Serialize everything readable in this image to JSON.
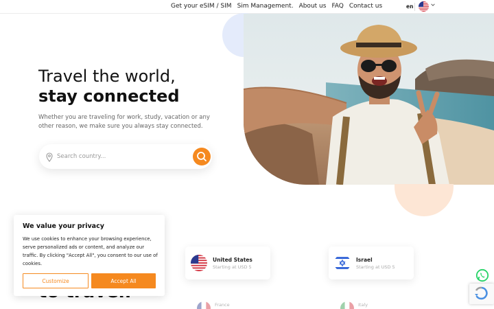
{
  "nav": {
    "items": [
      {
        "label": "Get your eSIM / SIM"
      },
      {
        "label": "Sim Management."
      },
      {
        "label": "About us"
      },
      {
        "label": "FAQ"
      },
      {
        "label": "Contact us"
      }
    ],
    "language": "en"
  },
  "hero": {
    "title_line1": "Travel the world,",
    "title_line2": "stay connected",
    "subtitle": "Whether you are traveling for work, study, vacation or any other reason, we make sure you always stay connected."
  },
  "search": {
    "placeholder": "Search country..."
  },
  "countries": [
    {
      "name": "United States",
      "price": "Starting at USD 5"
    },
    {
      "name": "Israel",
      "price": "Starting at USD 5"
    },
    {
      "name": "France"
    },
    {
      "name": "Italy"
    }
  ],
  "section_heading_partial": "to travel.",
  "cookie": {
    "title": "We value your privacy",
    "text": "We use cookies to enhance your browsing experience, serve personalized ads or content, and analyze our traffic. By clicking \"Accept All\", you consent to our use of cookies.",
    "customize_label": "Customize",
    "accept_label": "Accept All"
  },
  "colors": {
    "accent": "#f5891f",
    "blue_blob": "#e4ebfb",
    "peach_blob": "#fde6d5",
    "whatsapp": "#25d366"
  },
  "icons": [
    "flag-us-icon",
    "chevron-down-icon",
    "location-pin-icon",
    "search-icon",
    "flag-israel-icon",
    "flag-france-icon",
    "flag-italy-icon",
    "whatsapp-icon",
    "recaptcha-icon"
  ]
}
